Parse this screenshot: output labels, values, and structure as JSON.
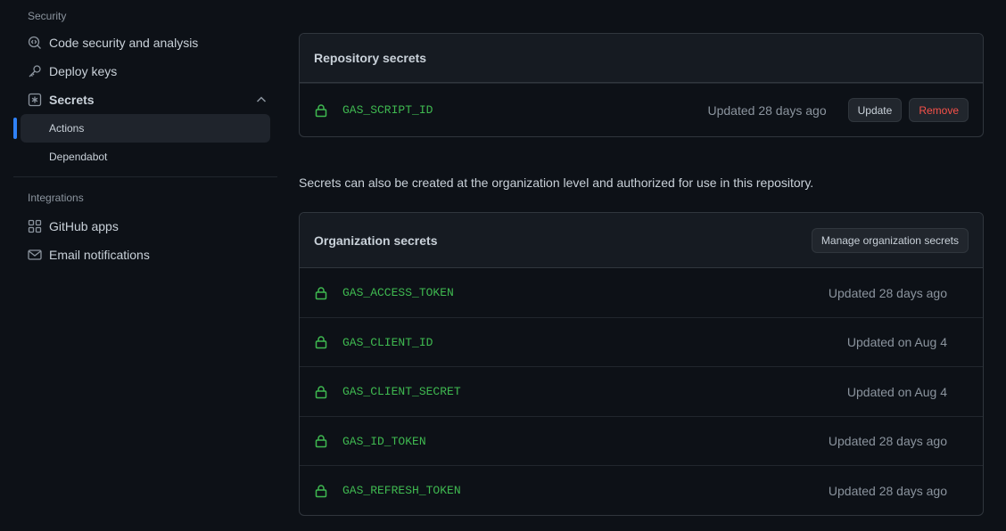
{
  "sidebar": {
    "security_heading": "Security",
    "code_security": "Code security and analysis",
    "deploy_keys": "Deploy keys",
    "secrets": "Secrets",
    "secrets_sub": [
      "Actions",
      "Dependabot"
    ],
    "integrations_heading": "Integrations",
    "github_apps": "GitHub apps",
    "email_notifications": "Email notifications"
  },
  "repo_secrets": {
    "title": "Repository secrets",
    "items": [
      {
        "name": "GAS_SCRIPT_ID",
        "updated": "Updated 28 days ago"
      }
    ],
    "update_label": "Update",
    "remove_label": "Remove"
  },
  "org_note": "Secrets can also be created at the organization level and authorized for use in this repository.",
  "org_secrets": {
    "title": "Organization secrets",
    "manage_label": "Manage organization secrets",
    "items": [
      {
        "name": "GAS_ACCESS_TOKEN",
        "updated": "Updated 28 days ago"
      },
      {
        "name": "GAS_CLIENT_ID",
        "updated": "Updated on Aug 4"
      },
      {
        "name": "GAS_CLIENT_SECRET",
        "updated": "Updated on Aug 4"
      },
      {
        "name": "GAS_ID_TOKEN",
        "updated": "Updated 28 days ago"
      },
      {
        "name": "GAS_REFRESH_TOKEN",
        "updated": "Updated 28 days ago"
      }
    ]
  },
  "colors": {
    "accent": "#2f81f7",
    "secret_green": "#3fb950",
    "danger": "#f85149"
  }
}
